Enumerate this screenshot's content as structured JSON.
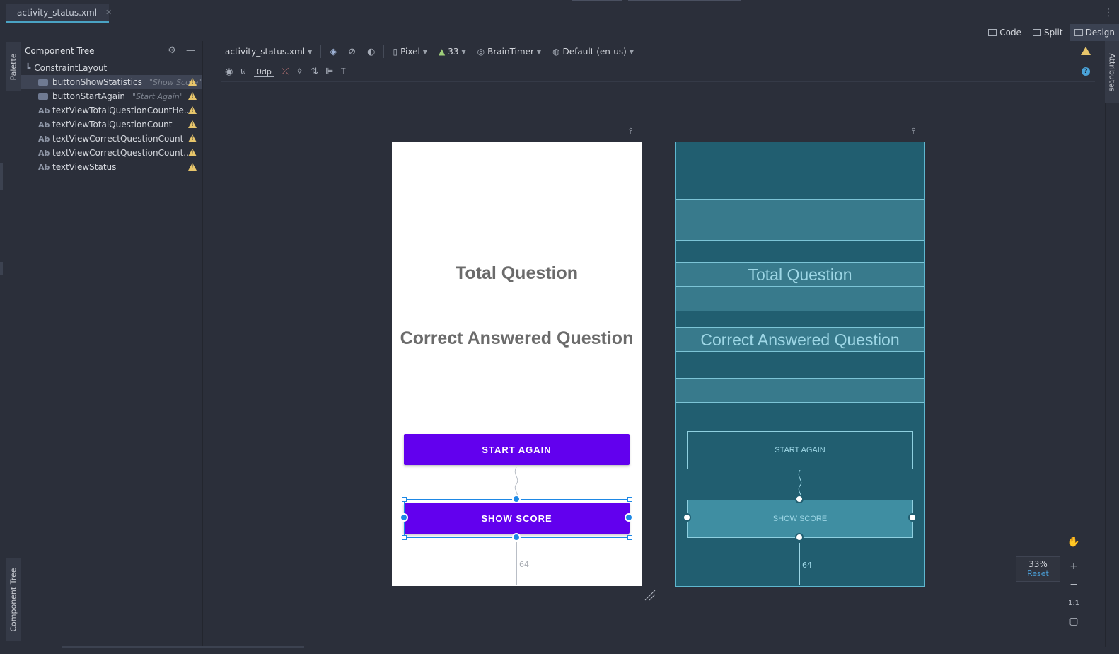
{
  "tab": {
    "filename": "activity_status.xml",
    "close": "✕"
  },
  "viewmodes": {
    "code": "Code",
    "split": "Split",
    "design": "Design"
  },
  "left_strip": {
    "palette": "Palette",
    "component_tree": "Component Tree"
  },
  "right_strip": {
    "attributes": "Attributes"
  },
  "tree": {
    "title": "Component Tree",
    "root": "ConstraintLayout",
    "items": [
      {
        "type": "button",
        "name": "buttonShowStatistics",
        "hint": "\"Show Score\"",
        "selected": true
      },
      {
        "type": "button",
        "name": "buttonStartAgain",
        "hint": "\"Start Again\"",
        "selected": false
      },
      {
        "type": "text",
        "name": "textViewTotalQuestionCountHe...",
        "hint": "",
        "selected": false
      },
      {
        "type": "text",
        "name": "textViewTotalQuestionCount",
        "hint": "",
        "selected": false
      },
      {
        "type": "text",
        "name": "textViewCorrectQuestionCount",
        "hint": "",
        "selected": false
      },
      {
        "type": "text",
        "name": "textViewCorrectQuestionCount...",
        "hint": "",
        "selected": false
      },
      {
        "type": "text",
        "name": "textViewStatus",
        "hint": "",
        "selected": false
      }
    ],
    "ab_label": "Ab"
  },
  "toolbar": {
    "file": "activity_status.xml",
    "device": "Pixel",
    "api": "33",
    "theme": "BrainTimer",
    "locale": "Default (en-us)",
    "margin": "0dp"
  },
  "screen": {
    "total_question": "Total Question",
    "correct_answered": "Correct Answered Question",
    "start_again": "START AGAIN",
    "show_score": "SHOW SCORE",
    "margin_bottom": "64"
  },
  "zoom": {
    "value": "33%",
    "reset": "Reset",
    "one_to_one": "1:1",
    "plus": "+",
    "minus": "−"
  },
  "colors": {
    "accent": "#6200ee",
    "selection": "#1e88e5",
    "blueprint": "#215e70"
  }
}
